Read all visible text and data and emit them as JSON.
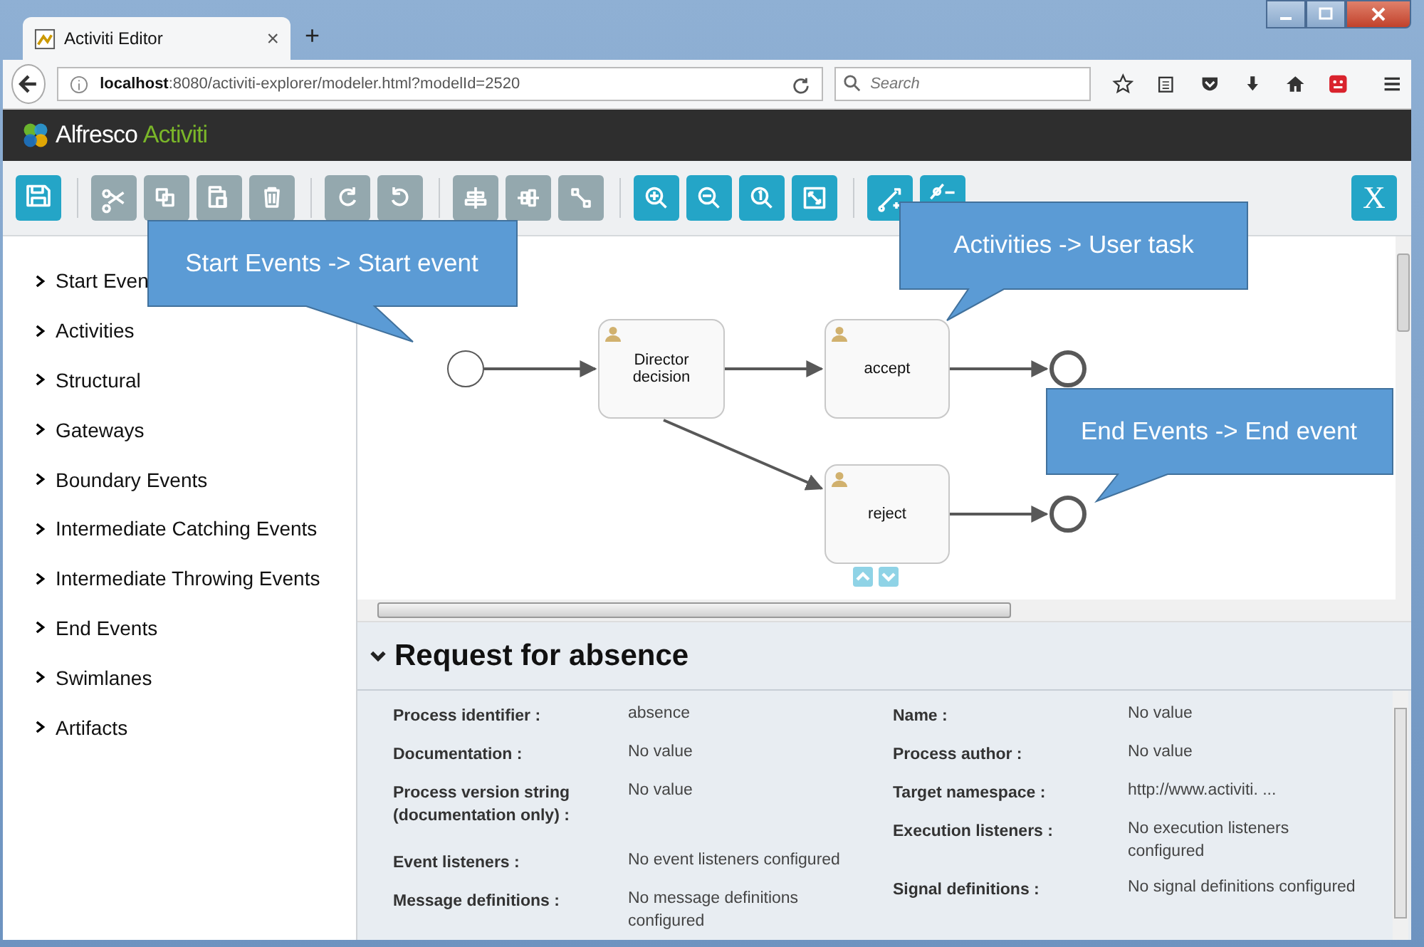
{
  "browser": {
    "tab": {
      "title": "Activiti Editor",
      "close": "×"
    },
    "new_tab": "+",
    "url": "**localhost**:8080/activiti-explorer/modeler.html?modelId=2520",
    "search": {
      "placeholder": "Search"
    }
  },
  "app": {
    "brand": "Alfresco",
    "product": "Activiti"
  },
  "toolbar": {
    "groups": [
      [
        {
          "disabled": false
        }
      ],
      [
        {
          "disabled": true
        },
        {
          "disabled": true
        },
        {
          "disabled": true
        },
        {
          "disabled": true
        }
      ],
      [
        {
          "disabled": true
        },
        {
          "disabled": true
        }
      ],
      [
        {
          "disabled": true
        },
        {
          "disabled": true
        },
        {
          "disabled": true
        }
      ],
      [
        {
          "disabled": false
        },
        {
          "disabled": false
        },
        {
          "disabled": false
        },
        {
          "disabled": false
        }
      ],
      [
        {
          "disabled": false
        },
        {
          "disabled": false
        }
      ]
    ],
    "close_label": "X"
  },
  "palette": [
    {
      "label": "Start Even"
    },
    {
      "label": "Activities"
    },
    {
      "label": "Structural"
    },
    {
      "label": "Gateways"
    },
    {
      "label": "Boundary Events"
    },
    {
      "label": "Intermediate Catching Events"
    },
    {
      "label": "Intermediate Throwing Events"
    },
    {
      "label": "End Events"
    },
    {
      "label": "Swimlanes"
    },
    {
      "label": "Artifacts"
    }
  ],
  "diagram": {
    "nodes": [
      {
        "kind": "start"
      },
      {
        "kind": "task",
        "label": "Director decision"
      },
      {
        "kind": "task",
        "label": "accept"
      },
      {
        "kind": "end"
      },
      {
        "kind": "task",
        "label": "reject"
      },
      {
        "kind": "end"
      }
    ]
  },
  "callouts": [
    {
      "text": "Start Events -> Start event"
    },
    {
      "text": "Activities -> User task"
    },
    {
      "text": "End Events -> End event"
    }
  ],
  "properties": {
    "title": "Request for absence",
    "columns": [
      [
        {
          "label": "Process identifier :",
          "value": "absence"
        },
        {
          "label": "Documentation :",
          "value": "No value"
        },
        {
          "label": "Process version string (documentation only) :",
          "value": "No value"
        },
        {
          "label": "Event listeners :",
          "value": "No event listeners configured"
        },
        {
          "label": "Message definitions :",
          "value": "No message definitions configured"
        }
      ],
      [
        {
          "label": "Name :",
          "value": "No value"
        },
        {
          "label": "Process author :",
          "value": "No value"
        },
        {
          "label": "Target namespace :",
          "value": "http://www.activiti. ..."
        },
        {
          "label": "Execution listeners :",
          "value": "No execution listeners configured"
        },
        {
          "label": "Signal definitions :",
          "value": "No signal definitions configured"
        }
      ]
    ]
  }
}
